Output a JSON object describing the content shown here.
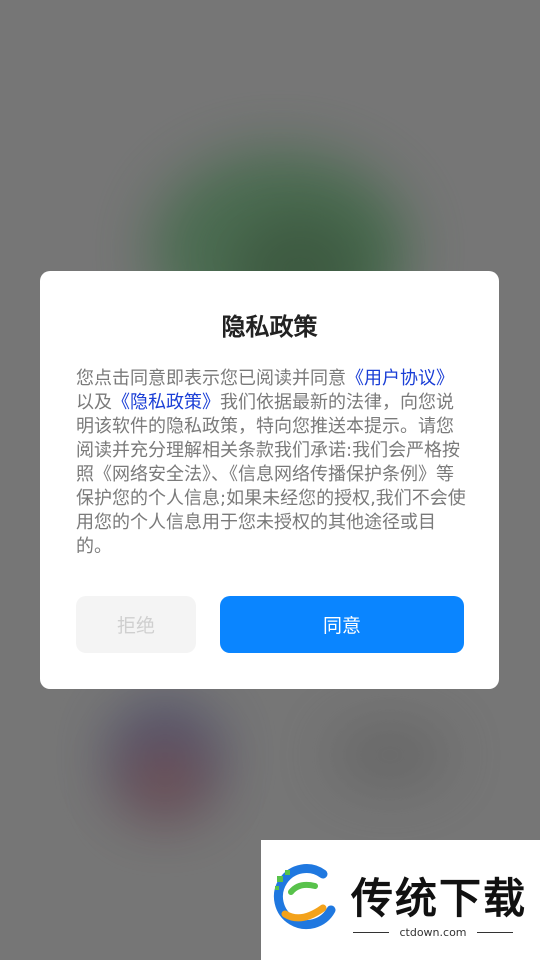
{
  "dialog": {
    "title": "隐私政策",
    "body_prefix": "您点击同意即表示您已阅读并同意",
    "link_user_agreement": "《用户协议》",
    "body_mid1": "以及",
    "link_privacy_policy": "《隐私政策》",
    "body_rest": "我们依据最新的法律，向您说明该软件的隐私政策，特向您推送本提示。请您阅读并充分理解相关条款我们承诺:我们会严格按照《网络安全法》、《信息网络传播保护条例》等保护您的个人信息;如果未经您的授权,我们不会使用您的个人信息用于您未授权的其他途径或目的。",
    "reject_label": "拒绝",
    "agree_label": "同意"
  },
  "watermark": {
    "title": "传统下载",
    "site": "ctdown.com"
  },
  "colors": {
    "agree_button": "#0a85ff",
    "link": "#1a3ed6",
    "body_text": "#7a7a7a"
  }
}
